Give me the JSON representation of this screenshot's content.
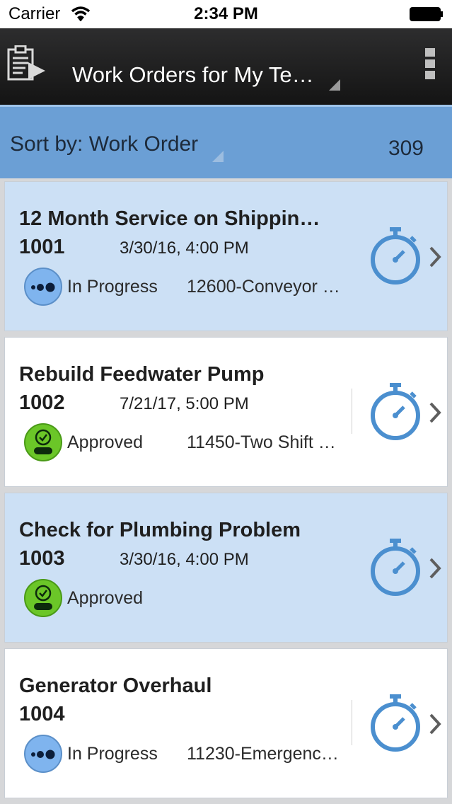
{
  "status_bar": {
    "carrier": "Carrier",
    "time": "2:34 PM"
  },
  "header": {
    "title": "Work Orders for My Te…",
    "app_icon": "work-order-icon",
    "menu_icon": "vertical-menu-icon"
  },
  "sort_bar": {
    "label": "Sort by: Work Order",
    "count": "309"
  },
  "colors": {
    "header_bg": "#1c1c1c",
    "sort_bar_bg": "#6b9fd5",
    "card_blue": "#cce0f5",
    "card_white": "#ffffff",
    "in_progress": "#7fb4ee",
    "approved": "#6bc628",
    "timer": "#4b8fcf"
  },
  "work_orders": [
    {
      "title": "12 Month Service on Shippin…",
      "number": "1001",
      "date": "3/30/16, 4:00 PM",
      "status": "In Progress",
      "status_icon": "in-progress-icon",
      "asset": "12600-Conveyor …"
    },
    {
      "title": "Rebuild Feedwater Pump",
      "number": "1002",
      "date": "7/21/17, 5:00 PM",
      "status": "Approved",
      "status_icon": "approved-icon",
      "asset": "11450-Two Shift …"
    },
    {
      "title": "Check for Plumbing Problem",
      "number": "1003",
      "date": "3/30/16, 4:00 PM",
      "status": "Approved",
      "status_icon": "approved-icon",
      "asset": ""
    },
    {
      "title": "Generator Overhaul",
      "number": "1004",
      "date": "",
      "status": "In Progress",
      "status_icon": "in-progress-icon",
      "asset": "11230-Emergenc…"
    }
  ]
}
